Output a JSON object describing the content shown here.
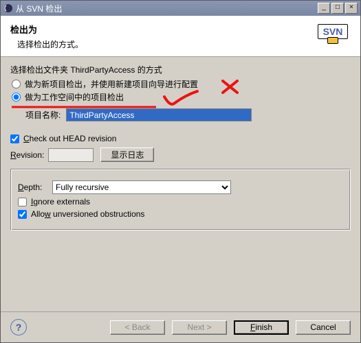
{
  "titlebar": {
    "title": "从 SVN 检出"
  },
  "header": {
    "title": "检出为",
    "subtitle": "选择检出的方式。"
  },
  "radios": {
    "prompt_prefix": "选择检出文件夹 ",
    "folder": "ThirdPartyAccess",
    "prompt_suffix": " 的方式",
    "opt1": "做为新项目检出，并使用新建项目向导进行配置",
    "opt2": "做为工作空间中的项目检出",
    "selected": "opt2"
  },
  "project": {
    "label": "项目名称:",
    "value": "ThirdPartyAccess"
  },
  "head": {
    "label": "Check out HEAD revision",
    "checked": true
  },
  "revision": {
    "label": "Revision:",
    "value": "",
    "button": "显示日志"
  },
  "depth": {
    "label": "Depth:",
    "value": "Fully recursive",
    "ignore_externals": {
      "label": "Ignore externals",
      "checked": false
    },
    "allow_unversioned": {
      "label": "Allow unversioned obstructions",
      "checked": true
    }
  },
  "footer": {
    "back": "< Back",
    "next": "Next >",
    "finish": "Finish",
    "cancel": "Cancel"
  }
}
